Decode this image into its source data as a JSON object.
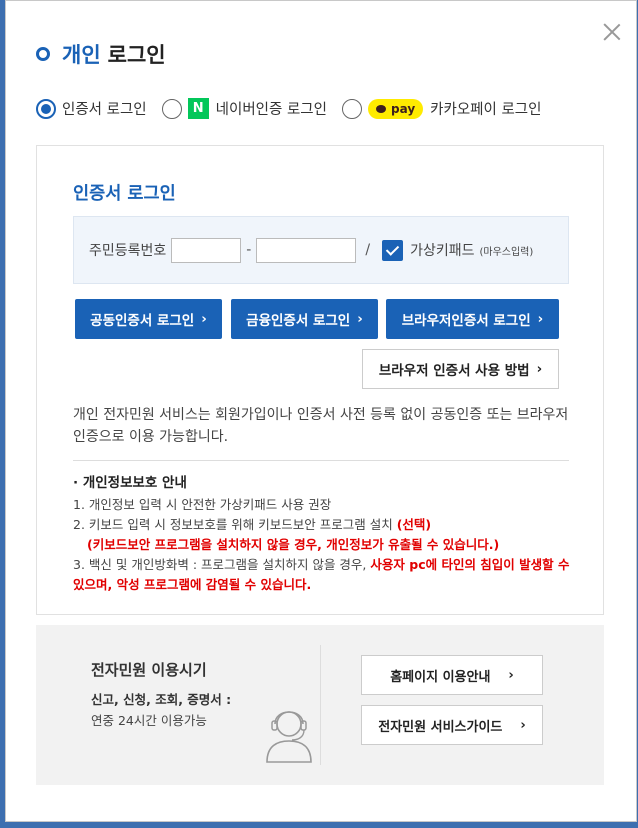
{
  "modal": {
    "title_blue": "개인",
    "title_black": "로그인"
  },
  "login_options": [
    {
      "label": "인증서 로그인",
      "selected": true
    },
    {
      "label": "네이버인증 로그인",
      "selected": false,
      "badge": "N"
    },
    {
      "label": "카카오페이 로그인",
      "selected": false,
      "badge": "pay"
    }
  ],
  "cert_login": {
    "heading": "인증서 로그인",
    "id_label": "주민등록번호",
    "dash": "-",
    "slash": "/",
    "keypad_label": "가상키패드",
    "keypad_note": "(마우스입력)",
    "keypad_checked": true,
    "buttons": {
      "public_cert": "공동인증서 로그인",
      "finance_cert": "금융인증서 로그인",
      "browser_cert": "브라우저인증서 로그인",
      "browser_howto": "브라우저 인증서 사용 방법"
    },
    "description": "개인 전자민원 서비스는 회원가입이나 인증서 사전 등록 없이 공동인증 또는 브라우저인증으로 이용 가능합니다."
  },
  "privacy": {
    "heading": "· 개인정보보호 안내",
    "item1": "1. 개인정보 입력 시 안전한 가상키패드 사용 권장",
    "item2": "2. 키보드 입력 시 정보보호를 위해 키보드보안 프로그램 설치",
    "item2_red": "(선택)",
    "item2_warn": "(키보드보안 프로그램을 설치하지 않을 경우, 개인정보가 유출될 수 있습니다.)",
    "item3": "3. 백신 및 개인방화벽 : 프로그램을 설치하지 않을 경우,",
    "item3_red": "사용자 pc에 타인의 침입이 발생할 수 있으며, 악성 프로그램에 감염될 수 있습니다."
  },
  "service_hours": {
    "title": "전자민원 이용시기",
    "subtitle": "신고, 신청, 조회, 증명서 :",
    "hours": "연중 24시간 이용가능",
    "guide_button": "홈페이지 이용안내",
    "service_button": "전자민원 서비스가이드"
  },
  "colors": {
    "primary": "#1a62b6",
    "warning": "#e10000",
    "naver": "#03c75a",
    "kakao": "#ffeb00"
  }
}
